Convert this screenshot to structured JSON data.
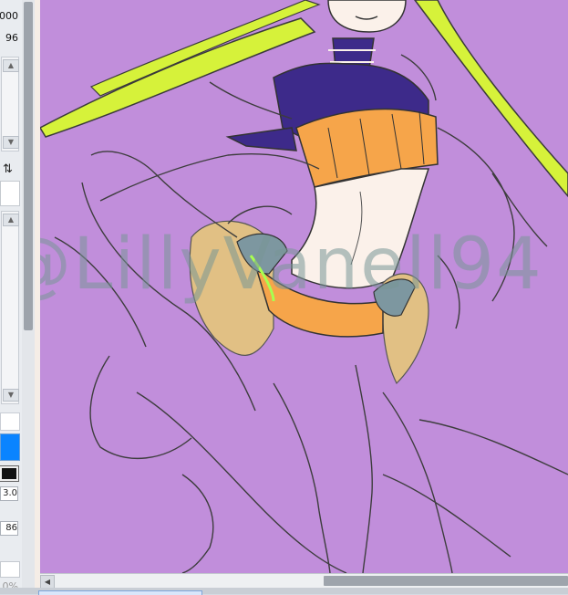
{
  "left_panel": {
    "values": [
      "000",
      "96",
      "3.0",
      "86",
      "0%"
    ],
    "swap_icon": "swap-arrows-icon"
  },
  "canvas": {
    "background": "#c18edb",
    "watermark": "@LillyVanell94"
  },
  "colors": {
    "primary_swatch": "#0a84ff",
    "secondary_swatch": "#ffffff",
    "stroke_swatch": "#111111",
    "hair": "#d6f23a",
    "top_dark": "#3d2a8a",
    "top_orange": "#f6a54a",
    "skirt_tan": "#e1c084",
    "skin": "#fbf1ea",
    "accent_teal": "#7d97a0"
  }
}
